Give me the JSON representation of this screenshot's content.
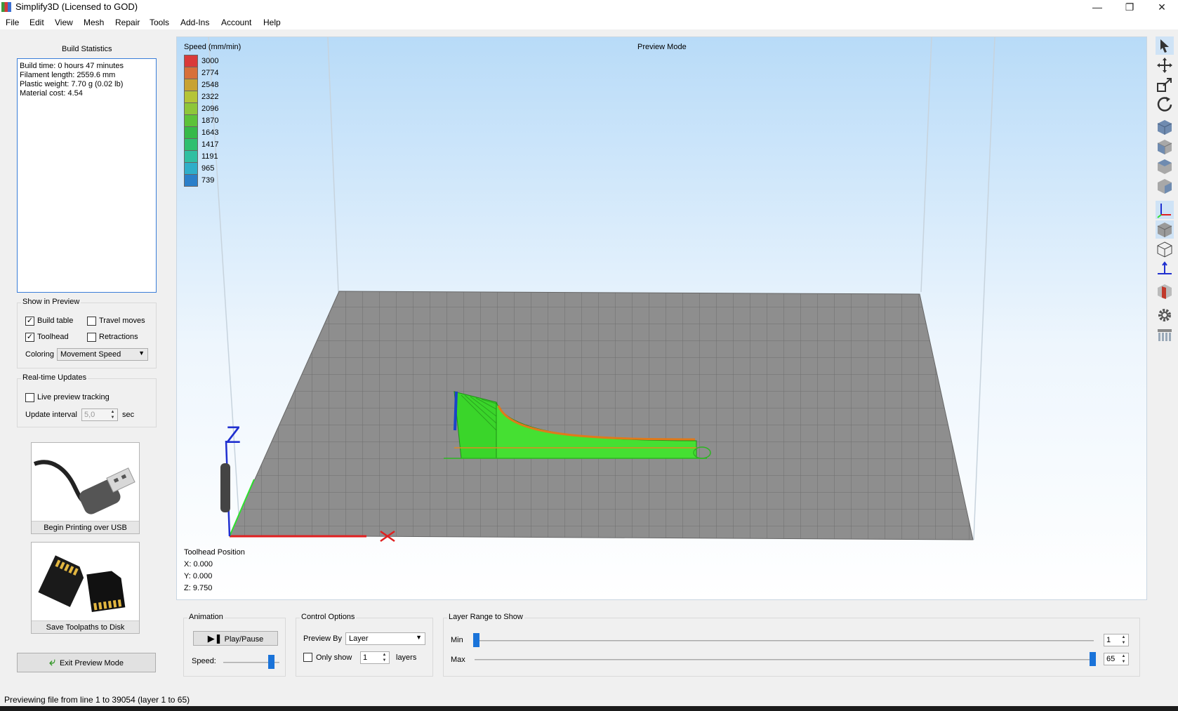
{
  "window": {
    "title": "Simplify3D (Licensed to GOD)"
  },
  "menu": [
    "File",
    "Edit",
    "View",
    "Mesh",
    "Repair",
    "Tools",
    "Add-Ins",
    "Account",
    "Help"
  ],
  "build_statistics": {
    "title": "Build Statistics",
    "lines": [
      "Build time: 0 hours 47 minutes",
      "Filament length: 2559.6 mm",
      "Plastic weight: 7.70 g (0.02 lb)",
      "Material cost: 4.54"
    ]
  },
  "show_in_preview": {
    "title": "Show in Preview",
    "build_table": {
      "label": "Build table",
      "checked": true
    },
    "travel_moves": {
      "label": "Travel moves",
      "checked": false
    },
    "toolhead": {
      "label": "Toolhead",
      "checked": true
    },
    "retractions": {
      "label": "Retractions",
      "checked": false
    },
    "coloring_label": "Coloring",
    "coloring_value": "Movement Speed"
  },
  "realtime_updates": {
    "title": "Real-time Updates",
    "live_preview_label": "Live preview tracking",
    "update_interval_label": "Update interval",
    "update_interval_value": "5,0",
    "unit": "sec"
  },
  "buttons": {
    "usb": "Begin Printing over USB",
    "disk": "Save Toolpaths to Disk",
    "exit_preview": "Exit Preview Mode"
  },
  "viewport": {
    "mode_label": "Preview Mode",
    "legend_title": "Speed (mm/min)",
    "legend": [
      {
        "value": "3000",
        "color": "#d93a3a"
      },
      {
        "value": "2774",
        "color": "#d7703a"
      },
      {
        "value": "2548",
        "color": "#c8a233"
      },
      {
        "value": "2322",
        "color": "#b5c437"
      },
      {
        "value": "2096",
        "color": "#8ec63a"
      },
      {
        "value": "1870",
        "color": "#5cc23a"
      },
      {
        "value": "1643",
        "color": "#36b94a"
      },
      {
        "value": "1417",
        "color": "#2fbf70"
      },
      {
        "value": "1191",
        "color": "#2fbfa2"
      },
      {
        "value": "965",
        "color": "#2eaec9"
      },
      {
        "value": "739",
        "color": "#2a7fc9"
      }
    ],
    "toolhead": {
      "title": "Toolhead Position",
      "x": "X: 0.000",
      "y": "Y: 0.000",
      "z": "Z: 9.750"
    },
    "axis_z": "Z"
  },
  "animation": {
    "title": "Animation",
    "play_label": "Play/Pause",
    "speed_label": "Speed:",
    "speed_level": 0.85
  },
  "control_options": {
    "title": "Control Options",
    "preview_by_label": "Preview By",
    "preview_by_value": "Layer",
    "only_show_label": "Only show",
    "only_show_value": "1",
    "layers_label": "layers"
  },
  "layer_range": {
    "title": "Layer Range to Show",
    "min_label": "Min",
    "max_label": "Max",
    "min_value": "1",
    "max_value": "65",
    "total_layers": 65
  },
  "status": {
    "text": "Previewing file from line 1 to 39054 (layer 1 to 65)"
  }
}
